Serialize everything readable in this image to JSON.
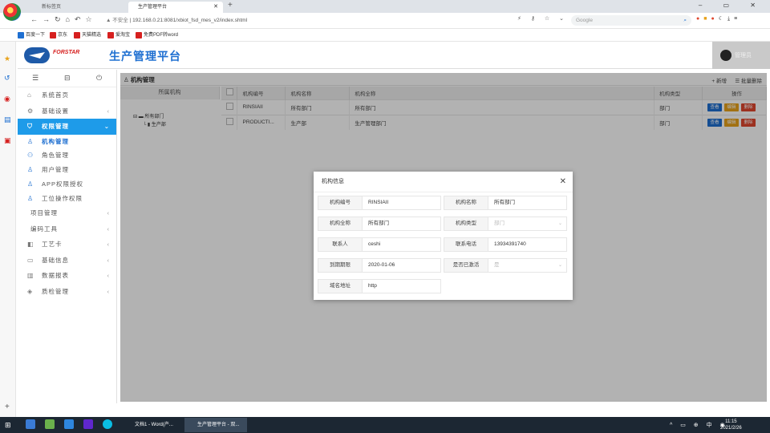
{
  "browser": {
    "tabs": [
      {
        "label": "新标签页"
      },
      {
        "label": "生产管理平台"
      }
    ],
    "url_insecure": "▲ 不安全",
    "url": "192.168.0.21:8081/xbiot_fsd_mes_v2/index.shtml",
    "search_placeholder": "Google",
    "bookmarks": [
      "百度一下",
      "京东",
      "天猫精选",
      "爱淘宝",
      "免费PDF转word"
    ]
  },
  "app": {
    "brand": "FORSTAR",
    "title": "生产管理平台",
    "user": "管理员"
  },
  "sidebar": {
    "items": [
      {
        "label": "系统首页",
        "icon": "home-icon"
      },
      {
        "label": "基础设置",
        "icon": "gear-icon"
      },
      {
        "label": "权限管理",
        "icon": "shield-icon"
      },
      {
        "label": "机构管理",
        "icon": "org-icon"
      },
      {
        "label": "角色管理",
        "icon": "role-icon"
      },
      {
        "label": "用户管理",
        "icon": "user-icon"
      },
      {
        "label": "APP权限授权",
        "icon": "user-icon"
      },
      {
        "label": "工位操作权限",
        "icon": "user-icon"
      },
      {
        "label": "项目管理"
      },
      {
        "label": "编码工具"
      },
      {
        "label": "工艺卡",
        "icon": "card-icon"
      },
      {
        "label": "基础信息",
        "icon": "monitor-icon"
      },
      {
        "label": "数据报表",
        "icon": "table-icon"
      },
      {
        "label": "质检管理",
        "icon": "layers-icon"
      }
    ]
  },
  "page": {
    "title": "机构管理",
    "add_label": "+ 新增",
    "batch_delete_label": "☰ 批量删除",
    "tree_header": "所属机构",
    "tree": [
      "所有部门",
      "生产部"
    ],
    "columns": [
      "机构编号",
      "机构名称",
      "机构全称",
      "机构类型",
      "操作"
    ],
    "rows": [
      {
        "code": "RINSIAII",
        "name": "所有部门",
        "fullname": "所有部门",
        "type": "部门"
      },
      {
        "code": "PRODUCTI...",
        "name": "生产部",
        "fullname": "生产管理部门",
        "type": "部门"
      }
    ],
    "ops": {
      "view": "查看",
      "edit": "编辑",
      "delete": "删除"
    }
  },
  "modal": {
    "title": "机构信息",
    "fields": {
      "code": {
        "label": "机构编号",
        "value": "RINSIAII"
      },
      "name": {
        "label": "机构名称",
        "value": "所有部门"
      },
      "fullname": {
        "label": "机构全称",
        "value": "所有部门"
      },
      "type": {
        "label": "机构类型",
        "value": "部门"
      },
      "contact": {
        "label": "联系人",
        "value": "ceshi"
      },
      "phone": {
        "label": "联系电话",
        "value": "13934391740"
      },
      "expiry": {
        "label": "到期期限",
        "value": "2020-01-06"
      },
      "activated": {
        "label": "是否已激活",
        "value": "是"
      },
      "domain": {
        "label": "域名地址",
        "value": "http"
      }
    }
  },
  "taskbar": {
    "tasks": [
      "文档1 - Word(产...",
      "生产管理平台 - 双..."
    ],
    "time": "11:15",
    "date": "2021/2/26",
    "ime": "中"
  }
}
